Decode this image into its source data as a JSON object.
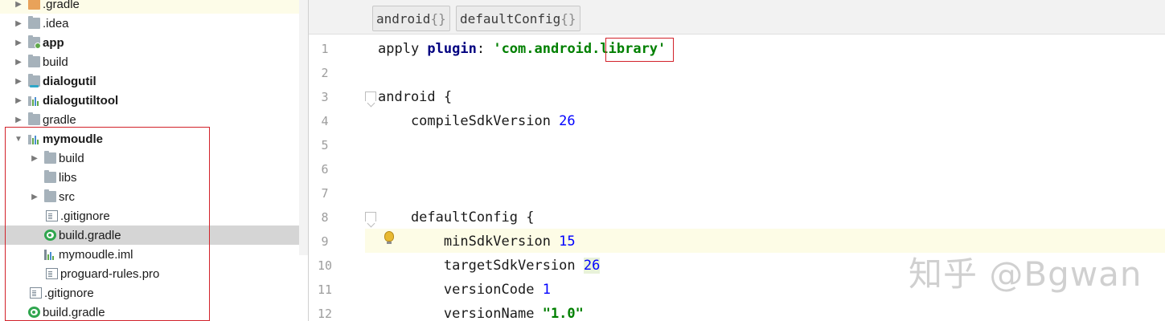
{
  "project_tree": {
    "items": [
      {
        "label": "gradle",
        "prefix": ".",
        "depth": 1,
        "expandable": true,
        "icon": "folder-orange-icon",
        "bold": false
      },
      {
        "label": ".idea",
        "depth": 1,
        "expandable": true,
        "icon": "folder-icon",
        "bold": false
      },
      {
        "label": "app",
        "depth": 1,
        "expandable": true,
        "icon": "module-folder-icon",
        "bold": true
      },
      {
        "label": "build",
        "depth": 1,
        "expandable": true,
        "icon": "folder-icon",
        "bold": false
      },
      {
        "label": "dialogutil",
        "depth": 1,
        "expandable": true,
        "icon": "library-module-icon",
        "bold": true
      },
      {
        "label": "dialogutiltool",
        "depth": 1,
        "expandable": true,
        "icon": "module-bars-icon",
        "bold": true
      },
      {
        "label": "gradle",
        "depth": 1,
        "expandable": true,
        "icon": "folder-icon",
        "bold": false
      },
      {
        "label": "mymoudle",
        "depth": 1,
        "expandable": true,
        "expanded": true,
        "icon": "module-bars-icon",
        "bold": true
      },
      {
        "label": "build",
        "depth": 2,
        "expandable": true,
        "icon": "folder-icon",
        "bold": false
      },
      {
        "label": "libs",
        "depth": 2,
        "expandable": false,
        "icon": "folder-icon",
        "bold": false
      },
      {
        "label": "src",
        "depth": 2,
        "expandable": true,
        "icon": "folder-icon",
        "bold": false
      },
      {
        "label": ".gitignore",
        "depth": 2,
        "expandable": false,
        "icon": "file-icon",
        "bold": false
      },
      {
        "label": "build.gradle",
        "depth": 2,
        "expandable": false,
        "icon": "gradle-icon",
        "bold": false,
        "selected": true
      },
      {
        "label": "mymoudle.iml",
        "depth": 2,
        "expandable": false,
        "icon": "iml-icon",
        "bold": false
      },
      {
        "label": "proguard-rules.pro",
        "depth": 2,
        "expandable": false,
        "icon": "file-icon",
        "bold": false
      },
      {
        "label": ".gitignore",
        "depth": 1,
        "expandable": false,
        "icon": "file-icon",
        "bold": false
      },
      {
        "label": "build.gradle",
        "depth": 1,
        "expandable": false,
        "icon": "gradle-icon",
        "bold": false
      }
    ]
  },
  "breadcrumbs": [
    {
      "label": "android",
      "brace": "{}"
    },
    {
      "label": "defaultConfig",
      "brace": "{}"
    }
  ],
  "editor": {
    "line_numbers": [
      "1",
      "2",
      "3",
      "4",
      "5",
      "6",
      "7",
      "8",
      "9",
      "10",
      "11",
      "12"
    ],
    "lines": [
      {
        "tokens": [
          {
            "t": "apply ",
            "c": ""
          },
          {
            "t": "plugin",
            "c": "kw"
          },
          {
            "t": ": ",
            "c": ""
          },
          {
            "t": "'com.android.",
            "c": "str"
          },
          {
            "t": "library",
            "c": "str"
          },
          {
            "t": "'",
            "c": "str"
          }
        ]
      },
      {
        "tokens": []
      },
      {
        "tokens": [
          {
            "t": "android ",
            "c": ""
          },
          {
            "t": "{",
            "c": ""
          }
        ]
      },
      {
        "tokens": [
          {
            "t": "    compileSdkVersion ",
            "c": ""
          },
          {
            "t": "26",
            "c": "num"
          }
        ]
      },
      {
        "tokens": []
      },
      {
        "tokens": []
      },
      {
        "tokens": []
      },
      {
        "tokens": [
          {
            "t": "    defaultConfig ",
            "c": ""
          },
          {
            "t": "{",
            "c": ""
          }
        ]
      },
      {
        "tokens": [
          {
            "t": "        minSdkVersion ",
            "c": ""
          },
          {
            "t": "15",
            "c": "num"
          }
        ]
      },
      {
        "tokens": [
          {
            "t": "        targetSdkVersion ",
            "c": ""
          },
          {
            "t": "26",
            "c": "num match"
          }
        ]
      },
      {
        "tokens": [
          {
            "t": "        versionCode ",
            "c": ""
          },
          {
            "t": "1",
            "c": "num"
          }
        ]
      },
      {
        "tokens": [
          {
            "t": "        versionName ",
            "c": ""
          },
          {
            "t": "\"1.0\"",
            "c": "str"
          }
        ]
      }
    ]
  },
  "watermark": "知乎 @Bgwan",
  "colors": {
    "annotation_red": "#d2222a",
    "caret_line": "#fdfce6",
    "string_green": "#008000",
    "keyword_navy": "#000080",
    "number_blue": "#0000ff"
  }
}
